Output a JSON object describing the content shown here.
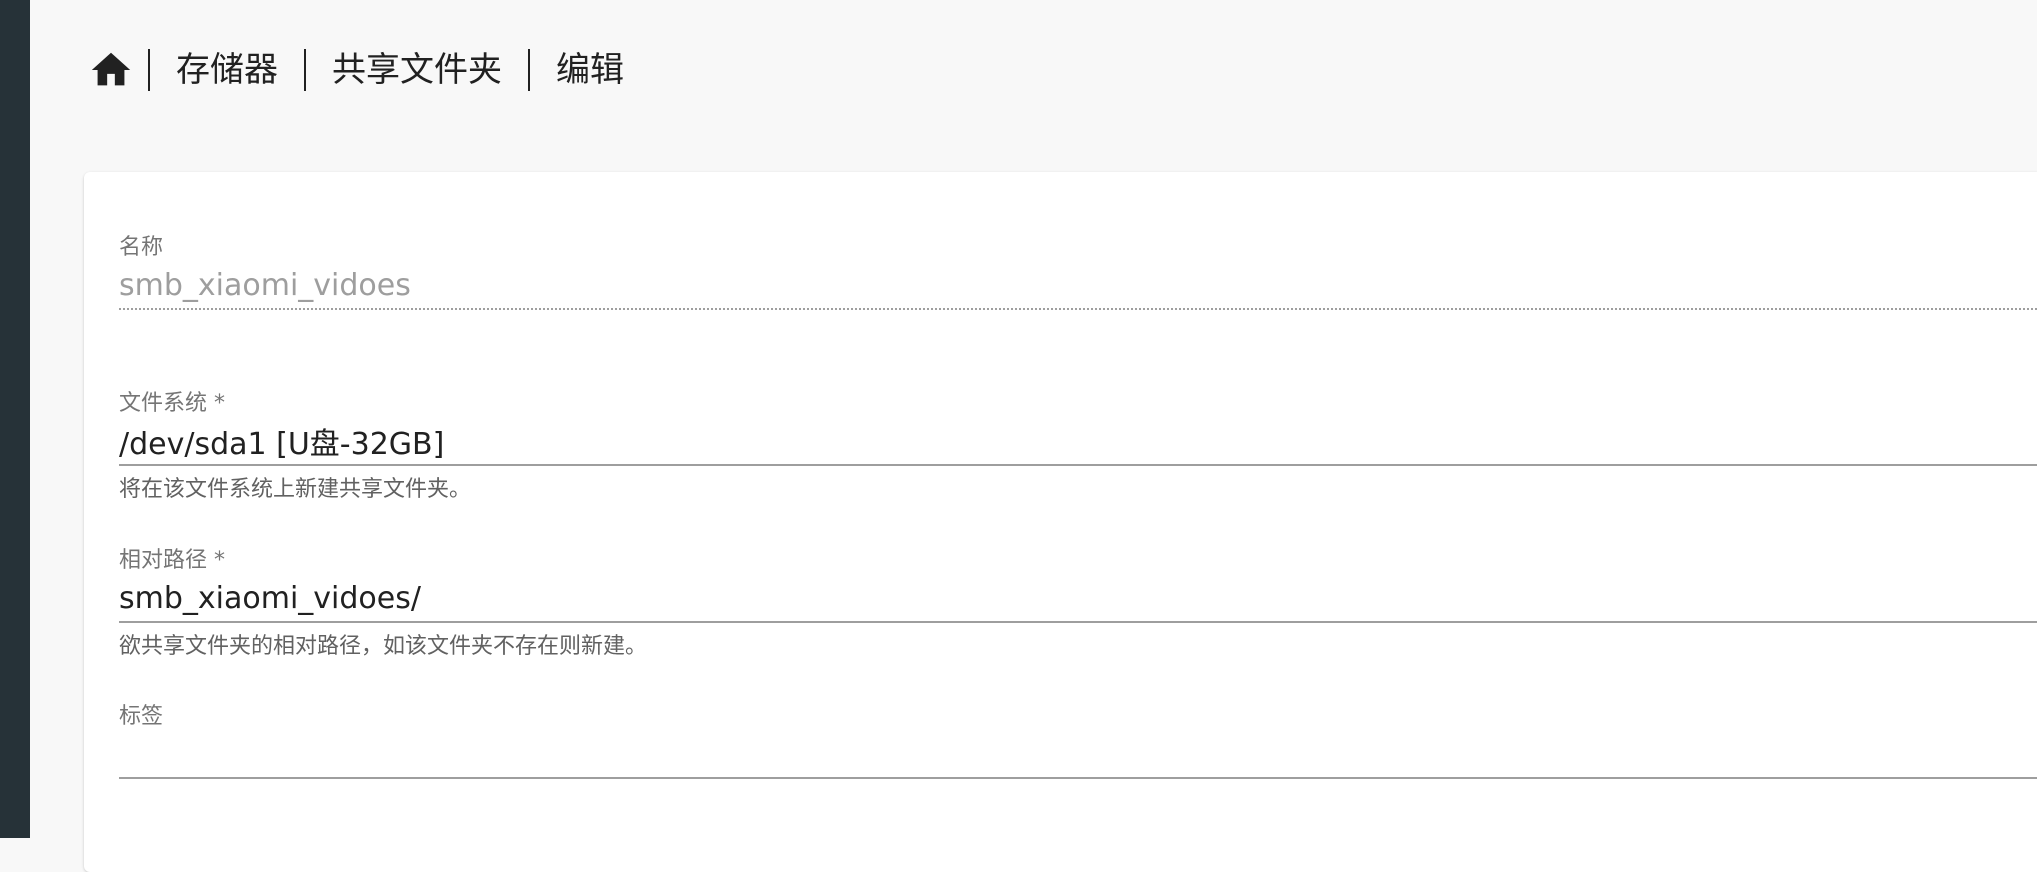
{
  "breadcrumb": {
    "home_icon": "home-icon",
    "items": [
      "存储器",
      "共享文件夹",
      "编辑"
    ]
  },
  "form": {
    "name": {
      "label": "名称",
      "value": "smb_xiaomi_vidoes"
    },
    "filesystem": {
      "label": "文件系统 *",
      "value": "/dev/sda1 [U盘-32GB]",
      "hint": "将在该文件系统上新建共享文件夹。"
    },
    "relative_path": {
      "label": "相对路径 *",
      "value": "smb_xiaomi_vidoes/",
      "hint": "欲共享文件夹的相对路径，如该文件夹不存在则新建。"
    },
    "tags": {
      "label": "标签",
      "value": ""
    }
  },
  "colors": {
    "sidebar": "#263238",
    "background": "#f8f8f8",
    "card": "#ffffff",
    "text": "#212121",
    "muted": "#757575"
  }
}
